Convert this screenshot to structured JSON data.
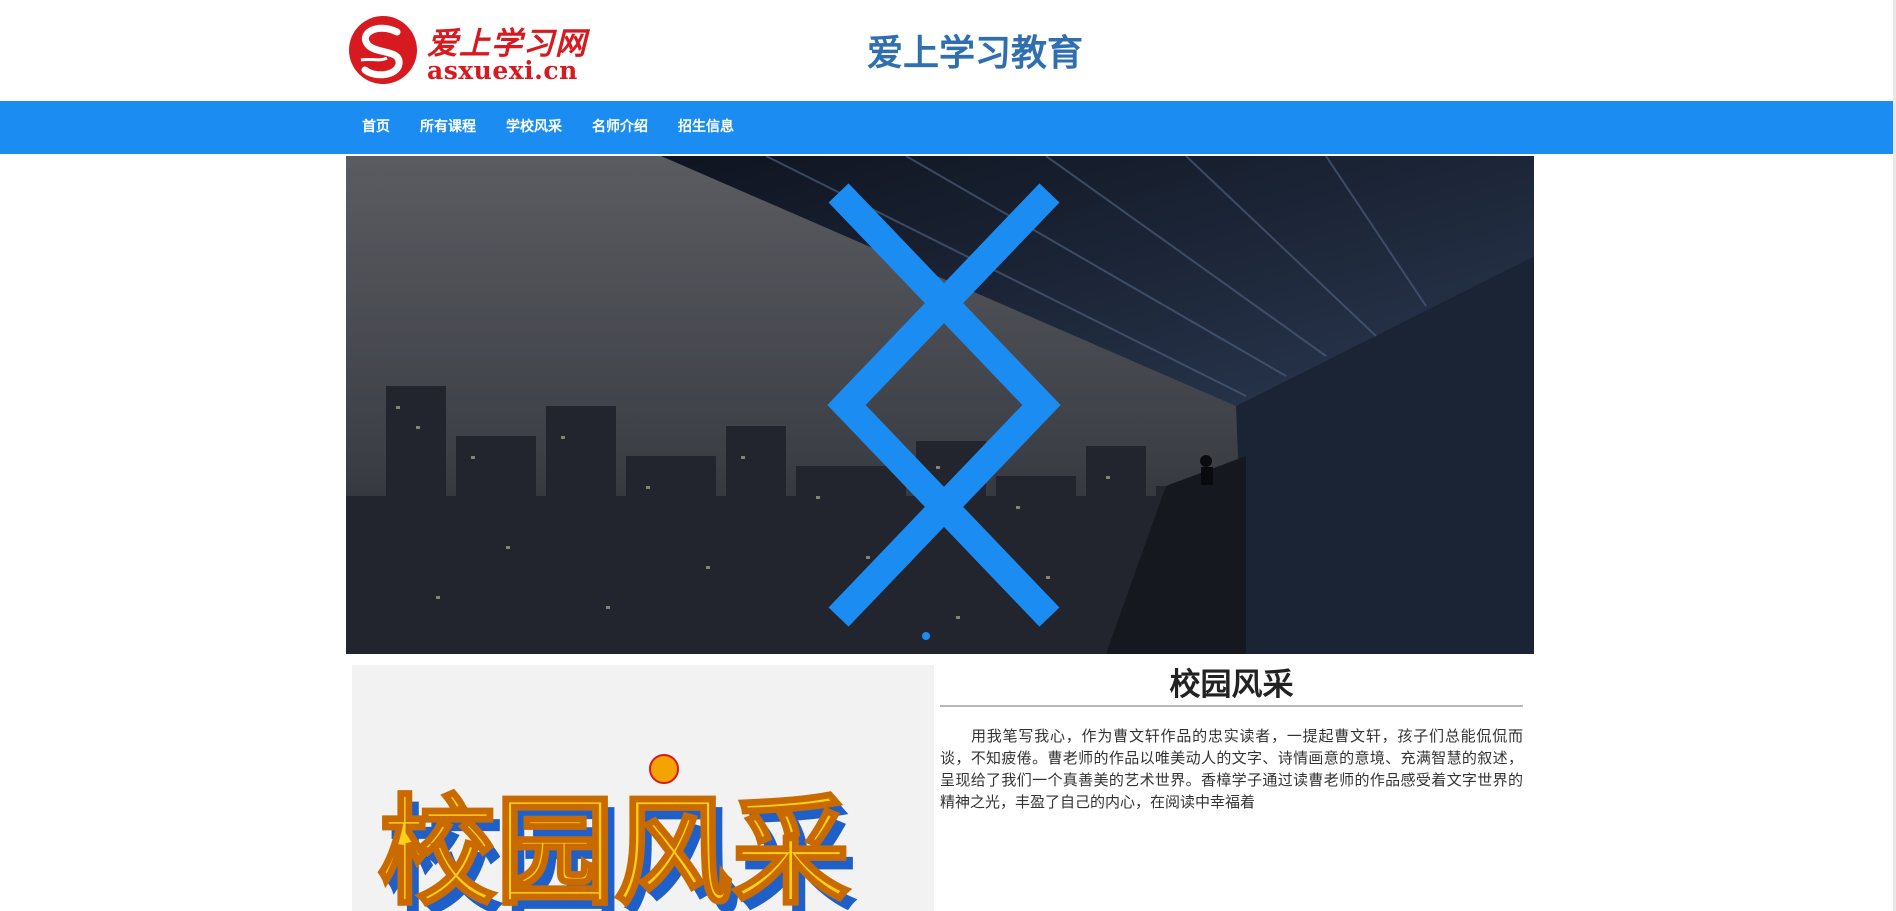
{
  "header": {
    "logo_cn": "爱上学习网",
    "logo_en": "asxuexi.cn",
    "site_title": "爱上学习教育"
  },
  "nav": {
    "items": [
      {
        "label": "首页"
      },
      {
        "label": "所有课程"
      },
      {
        "label": "学校风采"
      },
      {
        "label": "名师介绍"
      },
      {
        "label": "招生信息"
      }
    ]
  },
  "carousel": {
    "prev_icon": "chevron-left-icon",
    "next_icon": "chevron-right-icon",
    "slide_count": 1,
    "active_slide": 1
  },
  "section": {
    "image_text": "校园风采",
    "title": "校园风采",
    "body": "用我笔写我心，作为曹文轩作品的忠实读者，一提起曹文轩，孩子们总能侃侃而谈，不知疲倦。曹老师的作品以唯美动人的文字、诗情画意的意境、充满智慧的叙述，呈现给了我们一个真善美的艺术世界。香樟学子通过读曹老师的作品感受着文字世界的精神之光，丰盈了自己的内心，在阅读中幸福着"
  },
  "colors": {
    "nav_bg": "#1b8df2",
    "title_blue": "#2f6fb0",
    "logo_red": "#d71920"
  }
}
